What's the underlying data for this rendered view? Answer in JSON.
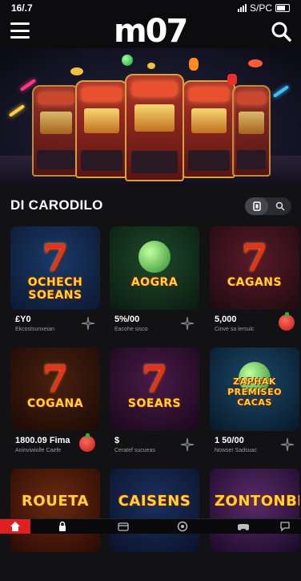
{
  "status_bar": {
    "time": "16/.7",
    "indicators": "S/PC"
  },
  "app": {
    "logo": "m07"
  },
  "hero": {
    "icons": [
      "slot-machine-icon",
      "gem-icon",
      "coin-icon"
    ]
  },
  "section": {
    "title": "DI CARODILO"
  },
  "games": [
    {
      "art_word": "7",
      "title": "OCHECH SOEANS",
      "price": "£Y0",
      "caption": "Ekcostsunxeian",
      "action": "sparkle-icon",
      "colors": [
        "#1a3a6a",
        "#0c1830"
      ]
    },
    {
      "art_word": "",
      "title": "AOGRA",
      "price": "5%/00",
      "caption": "Eacohe sisco",
      "action": "sparkle-icon",
      "colors": [
        "#1e4a2a",
        "#0a1a10"
      ]
    },
    {
      "art_word": "7",
      "title": "CAGANS",
      "price": "5,000",
      "caption": "Cinve sa lersulc",
      "action": "cherry-icon",
      "colors": [
        "#5a1a2a",
        "#1e0a10"
      ]
    },
    {
      "art_word": "7",
      "title": "COGANA",
      "price": "1800.09 Fima",
      "caption": "Aninviwiolle Caefe",
      "action": "cherry-icon",
      "colors": [
        "#4a2010",
        "#1a0a04"
      ]
    },
    {
      "art_word": "7",
      "title": "SOEARS",
      "price": "$",
      "caption": "Ceratef sucueas",
      "action": "sparkle-icon",
      "colors": [
        "#4a1a4a",
        "#180818"
      ]
    },
    {
      "art_word": "",
      "title": "ZAPHAK PREMISEO CACAS",
      "price": "1 50/00",
      "caption": "Nowser Sadsuac",
      "action": "sparkle-icon",
      "colors": [
        "#1a4a6a",
        "#081828"
      ]
    },
    {
      "art_word": "",
      "title": "ROUETA",
      "price": "",
      "caption": "",
      "action": "",
      "colors": [
        "#6a2a10",
        "#2a0a04"
      ]
    },
    {
      "art_word": "",
      "title": "CAISENS",
      "price": "",
      "caption": "",
      "action": "",
      "colors": [
        "#1a3060",
        "#0a1228"
      ]
    },
    {
      "art_word": "",
      "title": "ZONTONBPRES",
      "price": "",
      "caption": "",
      "action": "",
      "colors": [
        "#5a2a6a",
        "#1a0a28"
      ]
    }
  ],
  "nav": [
    "home-icon",
    "lock-icon",
    "wallet-icon",
    "chip-icon",
    "gamepad-icon",
    "chat-icon"
  ],
  "colors": {
    "accent": "#e02020",
    "background": "#121214",
    "card_text": "#ffd43a"
  }
}
